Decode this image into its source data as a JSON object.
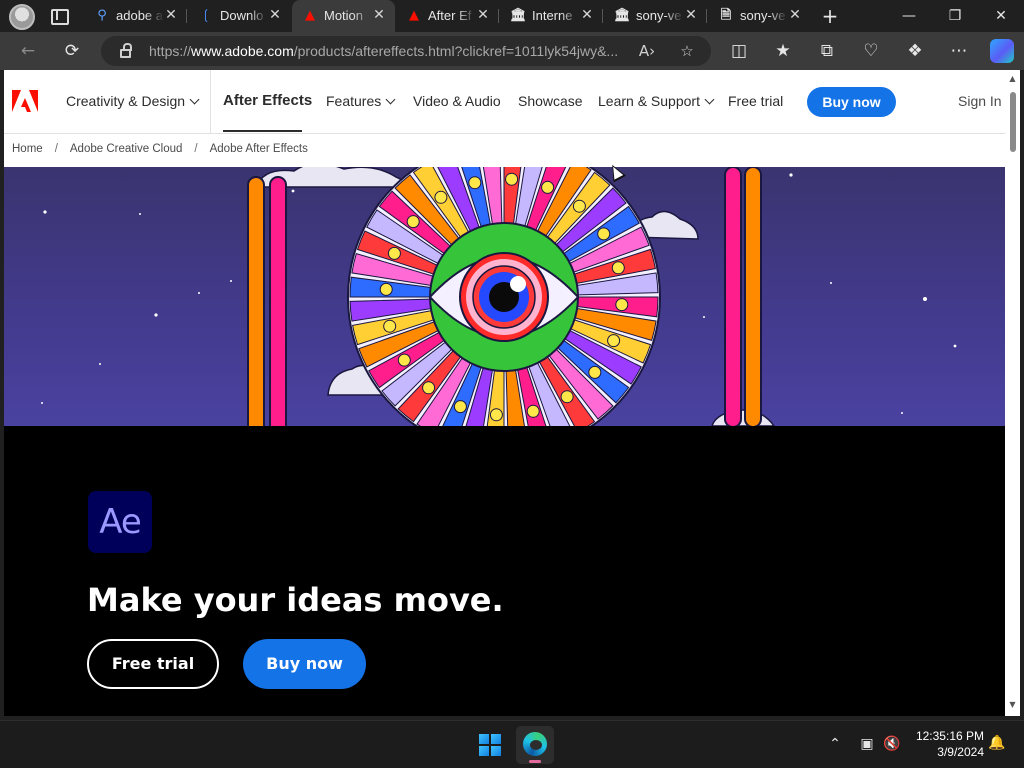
{
  "browser": {
    "tabs": [
      {
        "label": "adobe a",
        "icon": "search-icon"
      },
      {
        "label": "Downlo",
        "icon": "download-site-icon"
      },
      {
        "label": "Motion",
        "icon": "adobe-icon"
      },
      {
        "label": "After Ef",
        "icon": "adobe-icon"
      },
      {
        "label": "Interne",
        "icon": "archive-icon"
      },
      {
        "label": "sony-ve",
        "icon": "archive-icon"
      },
      {
        "label": "sony-ve",
        "icon": "page-icon"
      }
    ],
    "active_tab_index": 2,
    "url_prefix": "https://",
    "url_domain": "www.adobe.com",
    "url_rest": "/products/aftereffects.html?clickref=1011lyk54jwy&..."
  },
  "gnav": {
    "creativity_design": "Creativity & Design",
    "after_effects": "After Effects",
    "features": "Features",
    "video_audio": "Video & Audio",
    "showcase": "Showcase",
    "learn_support": "Learn & Support",
    "free_trial": "Free trial",
    "buy_now": "Buy now",
    "sign_in": "Sign In"
  },
  "breadcrumb": {
    "home": "Home",
    "creative_cloud": "Adobe Creative Cloud",
    "current": "Adobe After Effects"
  },
  "hero": {
    "logo_text": "Ae",
    "headline": "Make your ideas move.",
    "free_trial": "Free trial",
    "buy_now": "Buy now"
  },
  "taskbar": {
    "time": "12:35:16 PM",
    "date": "3/9/2024"
  },
  "colors": {
    "adobe_red": "#fa0f00",
    "cta_blue": "#1473e6",
    "ae_purple_bg": "#00005b",
    "ae_purple_text": "#9999ff"
  }
}
